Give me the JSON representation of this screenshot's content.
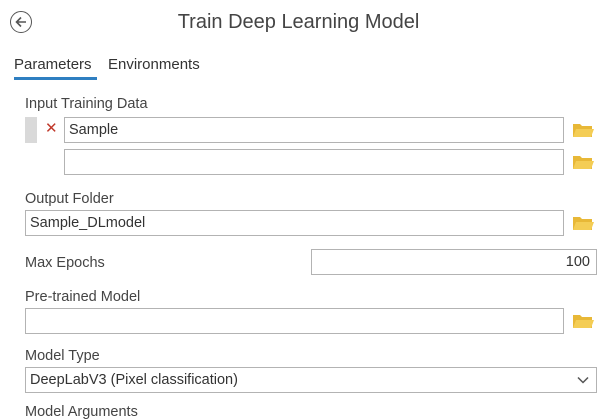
{
  "header": {
    "back_icon": "back-arrow-circle-icon",
    "title": "Train Deep Learning Model"
  },
  "tabs": [
    {
      "label": "Parameters",
      "active": true
    },
    {
      "label": "Environments",
      "active": false
    }
  ],
  "params": {
    "input_training_data": {
      "label": "Input Training Data",
      "values": [
        "Sample",
        ""
      ]
    },
    "output_folder": {
      "label": "Output Folder",
      "value": "Sample_DLmodel"
    },
    "max_epochs": {
      "label": "Max Epochs",
      "value": "100"
    },
    "pretrained_model": {
      "label": "Pre-trained Model",
      "value": ""
    },
    "model_type": {
      "label": "Model Type",
      "value": "DeepLabV3 (Pixel classification)"
    },
    "model_arguments": {
      "label": "Model Arguments"
    }
  },
  "colors": {
    "accent": "#2f7fc1",
    "folder": "#e8b837",
    "remove": "#c0392b"
  }
}
